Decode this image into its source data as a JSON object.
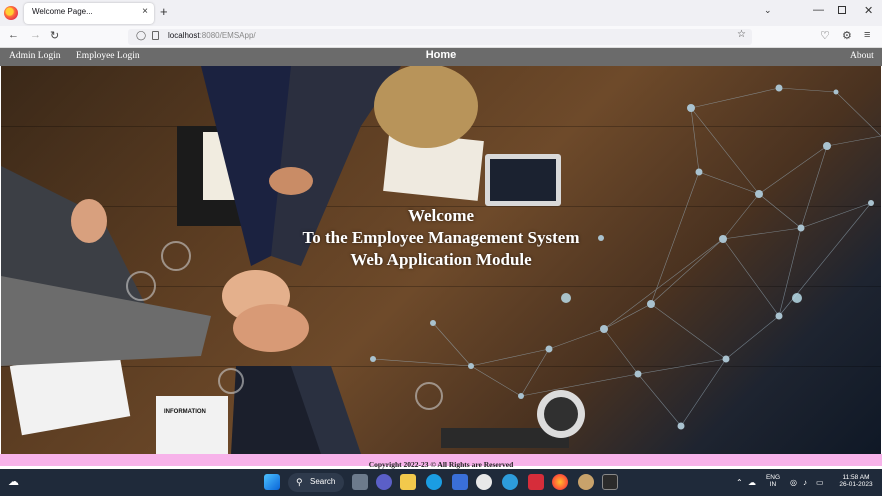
{
  "browser": {
    "tab_title": "Welcome Page...",
    "tab_close": "×",
    "new_tab": "+",
    "url_host": "localhost",
    "url_rest": ":8080/EMSApp/"
  },
  "header": {
    "admin_login": "Admin Login",
    "employee_login": "Employee Login",
    "home": "Home",
    "about": "About"
  },
  "hero": {
    "line1": "Welcome",
    "line2": "To the Employee Management System",
    "line3": "Web Application Module"
  },
  "footer": {
    "copyright": "Copyright 2022-23 © All Rights are Reserved"
  },
  "taskbar": {
    "search": "Search",
    "lang1": "ENG",
    "lang2": "IN",
    "time": "11:58 AM",
    "date": "26-01-2023"
  },
  "colors": {
    "header_bg": "#6b6b6b",
    "footer_bg": "#f7b3ea",
    "taskbar_bg": "#1f2a3a"
  }
}
